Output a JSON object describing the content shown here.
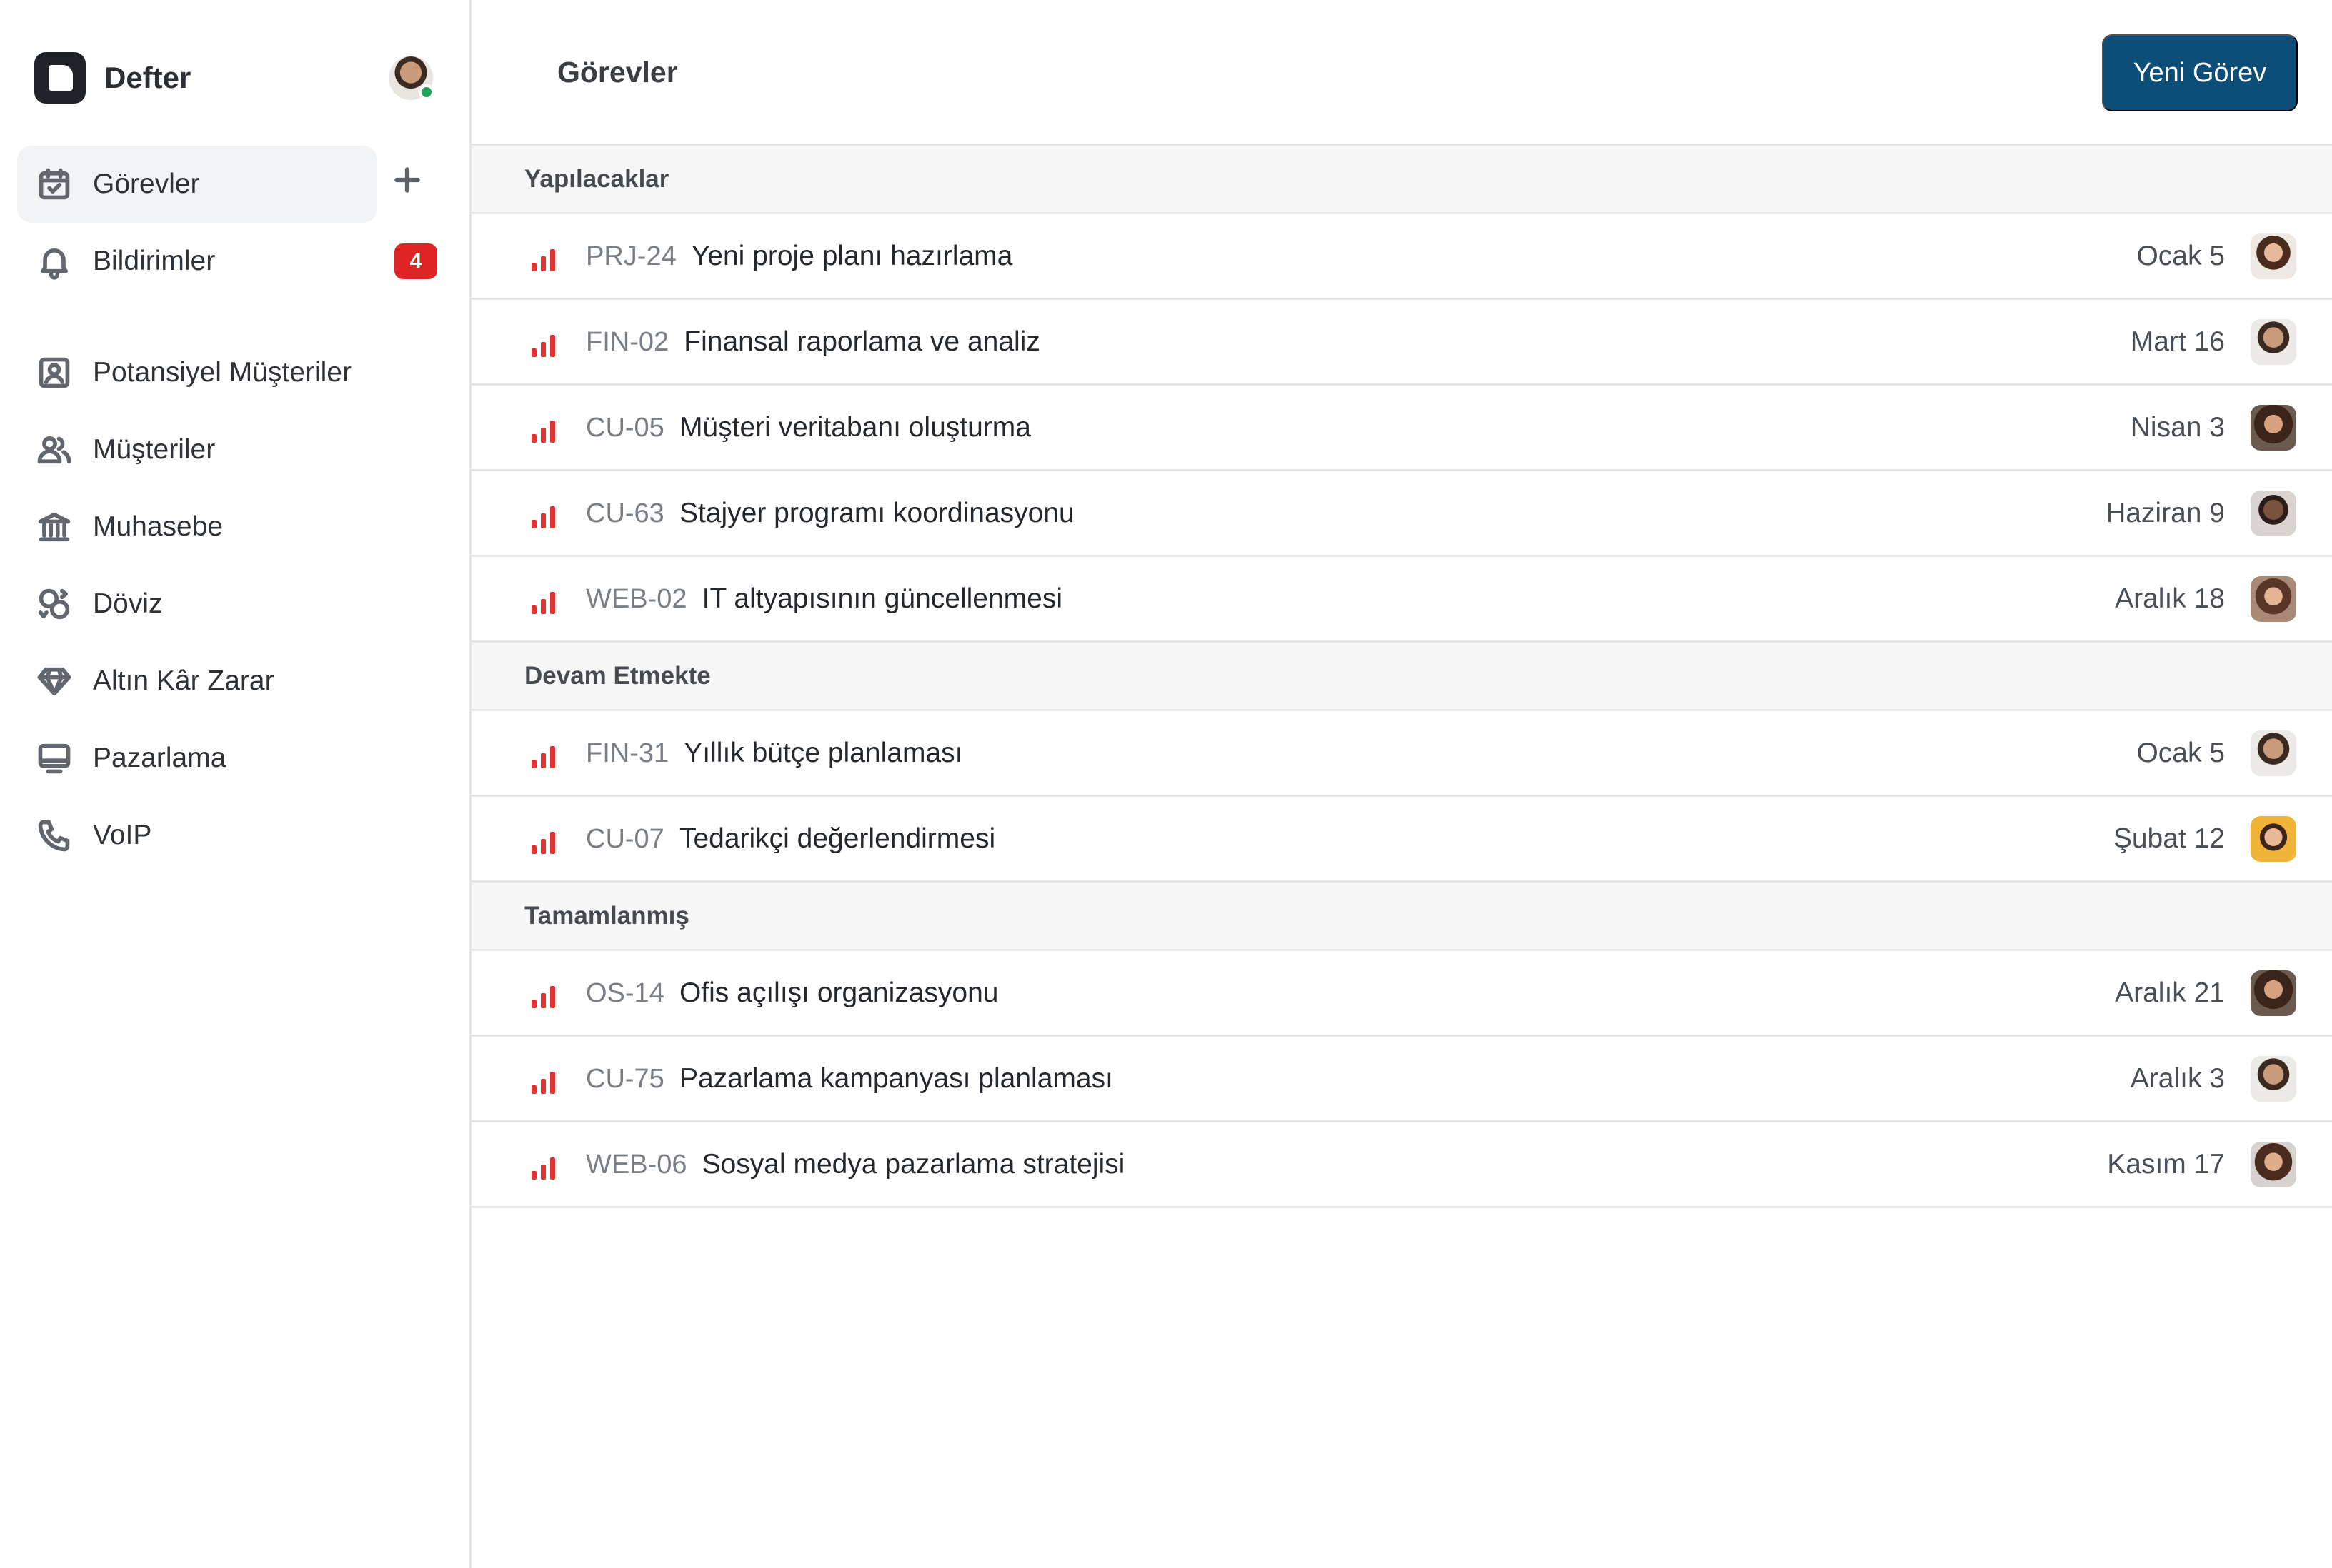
{
  "brand": {
    "name": "Defter"
  },
  "sidebar": {
    "items": [
      {
        "label": "Görevler",
        "icon": "calendar-check-icon"
      },
      {
        "label": "Bildirimler",
        "icon": "bell-icon",
        "badge": "4"
      },
      {
        "label": "Potansiyel Müşteriler",
        "icon": "contact-card-icon"
      },
      {
        "label": "Müşteriler",
        "icon": "users-icon"
      },
      {
        "label": "Muhasebe",
        "icon": "bank-icon"
      },
      {
        "label": "Döviz",
        "icon": "currency-exchange-icon"
      },
      {
        "label": "Altın Kâr Zarar",
        "icon": "diamond-icon"
      },
      {
        "label": "Pazarlama",
        "icon": "monitor-icon"
      },
      {
        "label": "VoIP",
        "icon": "phone-icon"
      }
    ]
  },
  "header": {
    "title": "Görevler",
    "new_button": "Yeni Görev"
  },
  "groups": [
    {
      "title": "Yapılacaklar",
      "tasks": [
        {
          "id": "PRJ-24",
          "title": "Yeni proje planı hazırlama",
          "date": "Ocak 5"
        },
        {
          "id": "FIN-02",
          "title": "Finansal raporlama ve analiz",
          "date": "Mart 16"
        },
        {
          "id": "CU-05",
          "title": "Müşteri veritabanı oluşturma",
          "date": "Nisan 3"
        },
        {
          "id": "CU-63",
          "title": "Stajyer programı koordinasyonu",
          "date": "Haziran 9"
        },
        {
          "id": "WEB-02",
          "title": "IT altyapısının güncellenmesi",
          "date": "Aralık 18"
        }
      ]
    },
    {
      "title": "Devam Etmekte",
      "tasks": [
        {
          "id": "FIN-31",
          "title": "Yıllık bütçe planlaması",
          "date": "Ocak 5"
        },
        {
          "id": "CU-07",
          "title": "Tedarikçi değerlendirmesi",
          "date": "Şubat 12"
        }
      ]
    },
    {
      "title": "Tamamlanmış",
      "tasks": [
        {
          "id": "OS-14",
          "title": "Ofis açılışı organizasyonu",
          "date": "Aralık 21"
        },
        {
          "id": "CU-75",
          "title": "Pazarlama kampanyası planlaması",
          "date": "Aralık 3"
        },
        {
          "id": "WEB-06",
          "title": "Sosyal medya pazarlama stratejisi",
          "date": "Kasım 17"
        }
      ]
    }
  ],
  "colors": {
    "accent": "#0d4e79",
    "priority": "#e13434",
    "badge": "#de2424",
    "online": "#22a35a"
  }
}
